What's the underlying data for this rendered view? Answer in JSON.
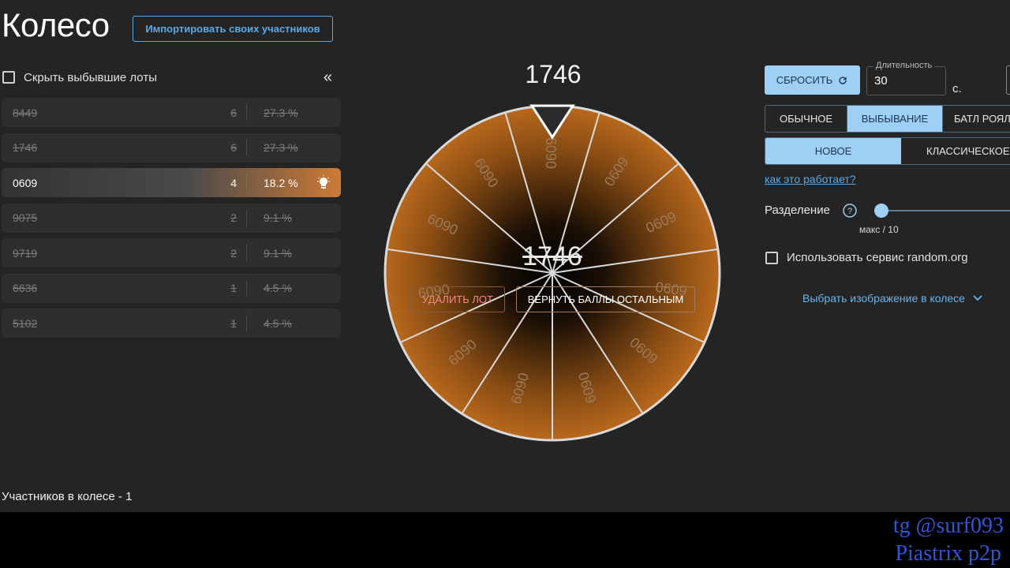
{
  "header": {
    "title": "Колесо",
    "import_label": "Импортировать своих участников"
  },
  "lots_panel": {
    "hide_label": "Скрыть выбывшие лоты",
    "collapse_icon": "double-chevron-left-icon",
    "items": [
      {
        "name": "8449",
        "count": "6",
        "percent": "27.3 %",
        "eliminated": true
      },
      {
        "name": "1746",
        "count": "6",
        "percent": "27.3 %",
        "eliminated": true
      },
      {
        "name": "0609",
        "count": "4",
        "percent": "18.2 %",
        "eliminated": false,
        "active": true
      },
      {
        "name": "9075",
        "count": "2",
        "percent": "9.1 %",
        "eliminated": true
      },
      {
        "name": "9719",
        "count": "2",
        "percent": "9.1 %",
        "eliminated": true
      },
      {
        "name": "6636",
        "count": "1",
        "percent": "4.5 %",
        "eliminated": true
      },
      {
        "name": "5102",
        "count": "1",
        "percent": "4.5 %",
        "eliminated": true
      }
    ],
    "participants_text": "Участников в колесе - 1"
  },
  "wheel": {
    "current_title": "1746",
    "overlay_label": "1746",
    "segment_label": "0609",
    "segment_count": 11,
    "delete_label": "УДАЛИТЬ ЛОТ",
    "return_label": "ВЕРНУТЬ БАЛЛЫ ОСТАЛЬНЫМ",
    "colors": {
      "segment": "#b8681c",
      "center": "#000000",
      "rim": "#d9d9d9"
    }
  },
  "controls": {
    "reset_label": "СБРОСИТЬ",
    "reset_icon": "refresh-icon",
    "duration_label": "Длительность",
    "duration_value": "30",
    "duration_unit": "с.",
    "modes": [
      "ОБЫЧНОЕ",
      "ВЫБЫВАНИЕ",
      "БАТЛ РОЯЛЬ"
    ],
    "selected_mode": "ВЫБЫВАНИЕ",
    "variants": [
      "НОВОЕ",
      "КЛАССИЧЕСКОЕ"
    ],
    "selected_variant": "НОВОЕ",
    "how_link": "как это работает?",
    "split_label": "Разделение",
    "split_value": 0,
    "split_caption": "макс / 10",
    "random_label": "Использовать сервис random.org",
    "image_select_label": "Выбрать изображение в колесе"
  },
  "watermark": {
    "line1": "tg @surf093",
    "line2": "Piastrix p2p"
  },
  "theme": {
    "accent": "#9ecff5",
    "link": "#5aa9e6",
    "active_lot": "#cc7a35"
  }
}
